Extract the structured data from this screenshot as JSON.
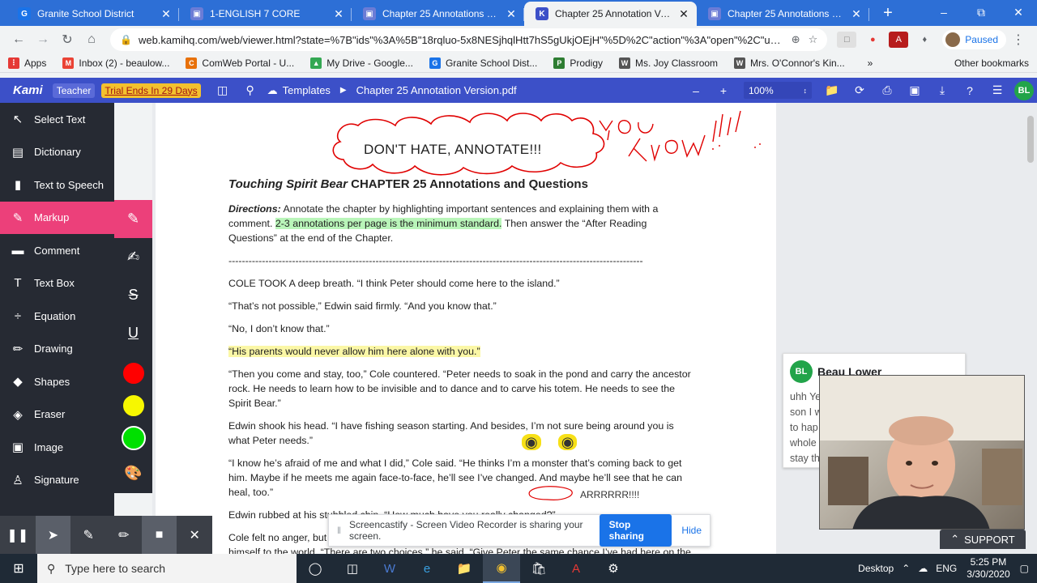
{
  "browser": {
    "tabs": [
      {
        "title": "Granite School District",
        "fav_color": "#1a73e8",
        "fav_letter": "G",
        "active": false
      },
      {
        "title": "1-ENGLISH 7 CORE",
        "fav_color": "#6b7cd6",
        "fav_letter": "▣",
        "active": false
      },
      {
        "title": "Chapter 25 Annotations and Q",
        "fav_color": "#6b7cd6",
        "fav_letter": "▣",
        "active": false
      },
      {
        "title": "Chapter 25 Annotation Version",
        "fav_color": "#3c50c8",
        "fav_letter": "K",
        "active": true
      },
      {
        "title": "Chapter 25 Annotations and Q",
        "fav_color": "#6b7cd6",
        "fav_letter": "▣",
        "active": false
      }
    ],
    "url": "web.kamihq.com/web/viewer.html?state=%7B\"ids\"%3A%5B\"18rqluo-5x8NESjhqlHtt7hS5gUkjOEjH\"%5D%2C\"action\"%3A\"open\"%2C\"userId\"...",
    "profile_status": "Paused",
    "bookmarks": [
      {
        "label": "Apps",
        "color": "#e53935",
        "glyph": "⋮"
      },
      {
        "label": "Inbox (2) - beaulow...",
        "color": "#ea4335",
        "glyph": "M"
      },
      {
        "label": "ComWeb Portal - U...",
        "color": "#e8710a",
        "glyph": "C"
      },
      {
        "label": "My Drive - Google...",
        "color": "#34a853",
        "glyph": "▲"
      },
      {
        "label": "Granite School Dist...",
        "color": "#1a73e8",
        "glyph": "G"
      },
      {
        "label": "Prodigy",
        "color": "#2e7d32",
        "glyph": "P"
      },
      {
        "label": "Ms. Joy Classroom",
        "color": "#555555",
        "glyph": "W"
      },
      {
        "label": "Mrs. O'Connor's Kin...",
        "color": "#555555",
        "glyph": "W"
      }
    ],
    "other_bookmarks": "Other bookmarks"
  },
  "kami": {
    "logo": "Kami",
    "role": "Teacher",
    "trial": "Trial Ends In 29 Days",
    "templates": "Templates",
    "filename": "Chapter 25 Annotation Version.pdf",
    "zoom": "100%",
    "user_initials": "BL"
  },
  "sidebar": {
    "items": [
      {
        "label": "Select Text",
        "icon": "↖"
      },
      {
        "label": "Dictionary",
        "icon": "▤"
      },
      {
        "label": "Text to Speech",
        "icon": "▮"
      },
      {
        "label": "Markup",
        "icon": "✎"
      },
      {
        "label": "Comment",
        "icon": "▬"
      },
      {
        "label": "Text Box",
        "icon": "T"
      },
      {
        "label": "Equation",
        "icon": "÷"
      },
      {
        "label": "Drawing",
        "icon": "✏"
      },
      {
        "label": "Shapes",
        "icon": "◆"
      },
      {
        "label": "Eraser",
        "icon": "◈"
      },
      {
        "label": "Image",
        "icon": "▣"
      },
      {
        "label": "Signature",
        "icon": "♙"
      }
    ],
    "active_index": 3,
    "swatches": [
      "#ff0000",
      "#f7f700",
      "#00e000"
    ]
  },
  "document": {
    "banner": "DON'T HATE, ANNOTATE!!!",
    "scribble": "You Know!!!",
    "title_italic": "Touching Spirit Bear",
    "title_rest": " CHAPTER 25 Annotations and Questions",
    "directions_label": "Directions:",
    "directions_1": " Annotate the chapter by highlighting important sentences and explaining them with a",
    "directions_2a": "comment.  ",
    "directions_highlight": "2-3 annotations per page is the minimum standard.",
    "directions_2b": "  Then answer the “After Reading",
    "directions_3": "Questions” at the end of the Chapter.",
    "divider": "----------------------------------------------------------------------------------------------------------------------------",
    "p1": "COLE TOOK A deep breath. “I think Peter should come here to the island.”",
    "p2": "“That’s not possible,” Edwin said firmly. “And you know that.”",
    "p3": "“No, I don’t know that.”",
    "p4": "“His parents would never allow him here alone with you.”",
    "p5a": "“Then you come and stay, too,” Cole countered. “Peter needs to soak in the pond and carry the ancestor",
    "p5b": "rock. He needs to learn how to be invisible and to dance and to carve his totem. He needs to see the",
    "p5c": "Spirit Bear.”",
    "p6a": "Edwin shook his head. “I have fishing season starting. And besides, I’m not sure being around you is",
    "p6b": "what Peter needs.”",
    "p7a": "“I know he’s afraid of me and what I did,” Cole said. “He thinks I’m a monster that’s coming back to get",
    "p7b": "him. Maybe if he meets me again face-to-face, he’ll see I’ve changed. And maybe he’ll see that he can",
    "p7c": "heal, too.”",
    "p8": "Edwin rubbed at his stubbled chin. “How much have you really changed?”",
    "p9a": "Cole felt no anger, but",
    "p9b": "himself to the world. “There are two choices,” he said. “Give Peter the same chance I’ve had here on the",
    "arr_note": "ARRRRRR!!!!"
  },
  "comment": {
    "initials": "BL",
    "author": "Beau Lower",
    "lines": [
      "uhh Ye",
      "son I w",
      "to hap",
      "whole",
      "stay th"
    ]
  },
  "recorder": {
    "share_text": "Screencastify - Screen Video Recorder is sharing your screen.",
    "stop": "Stop sharing",
    "hide": "Hide",
    "support": "SUPPORT"
  },
  "taskbar": {
    "search_placeholder": "Type here to search",
    "desktop": "Desktop",
    "lang": "ENG",
    "time": "5:25 PM",
    "date": "3/30/2020"
  }
}
